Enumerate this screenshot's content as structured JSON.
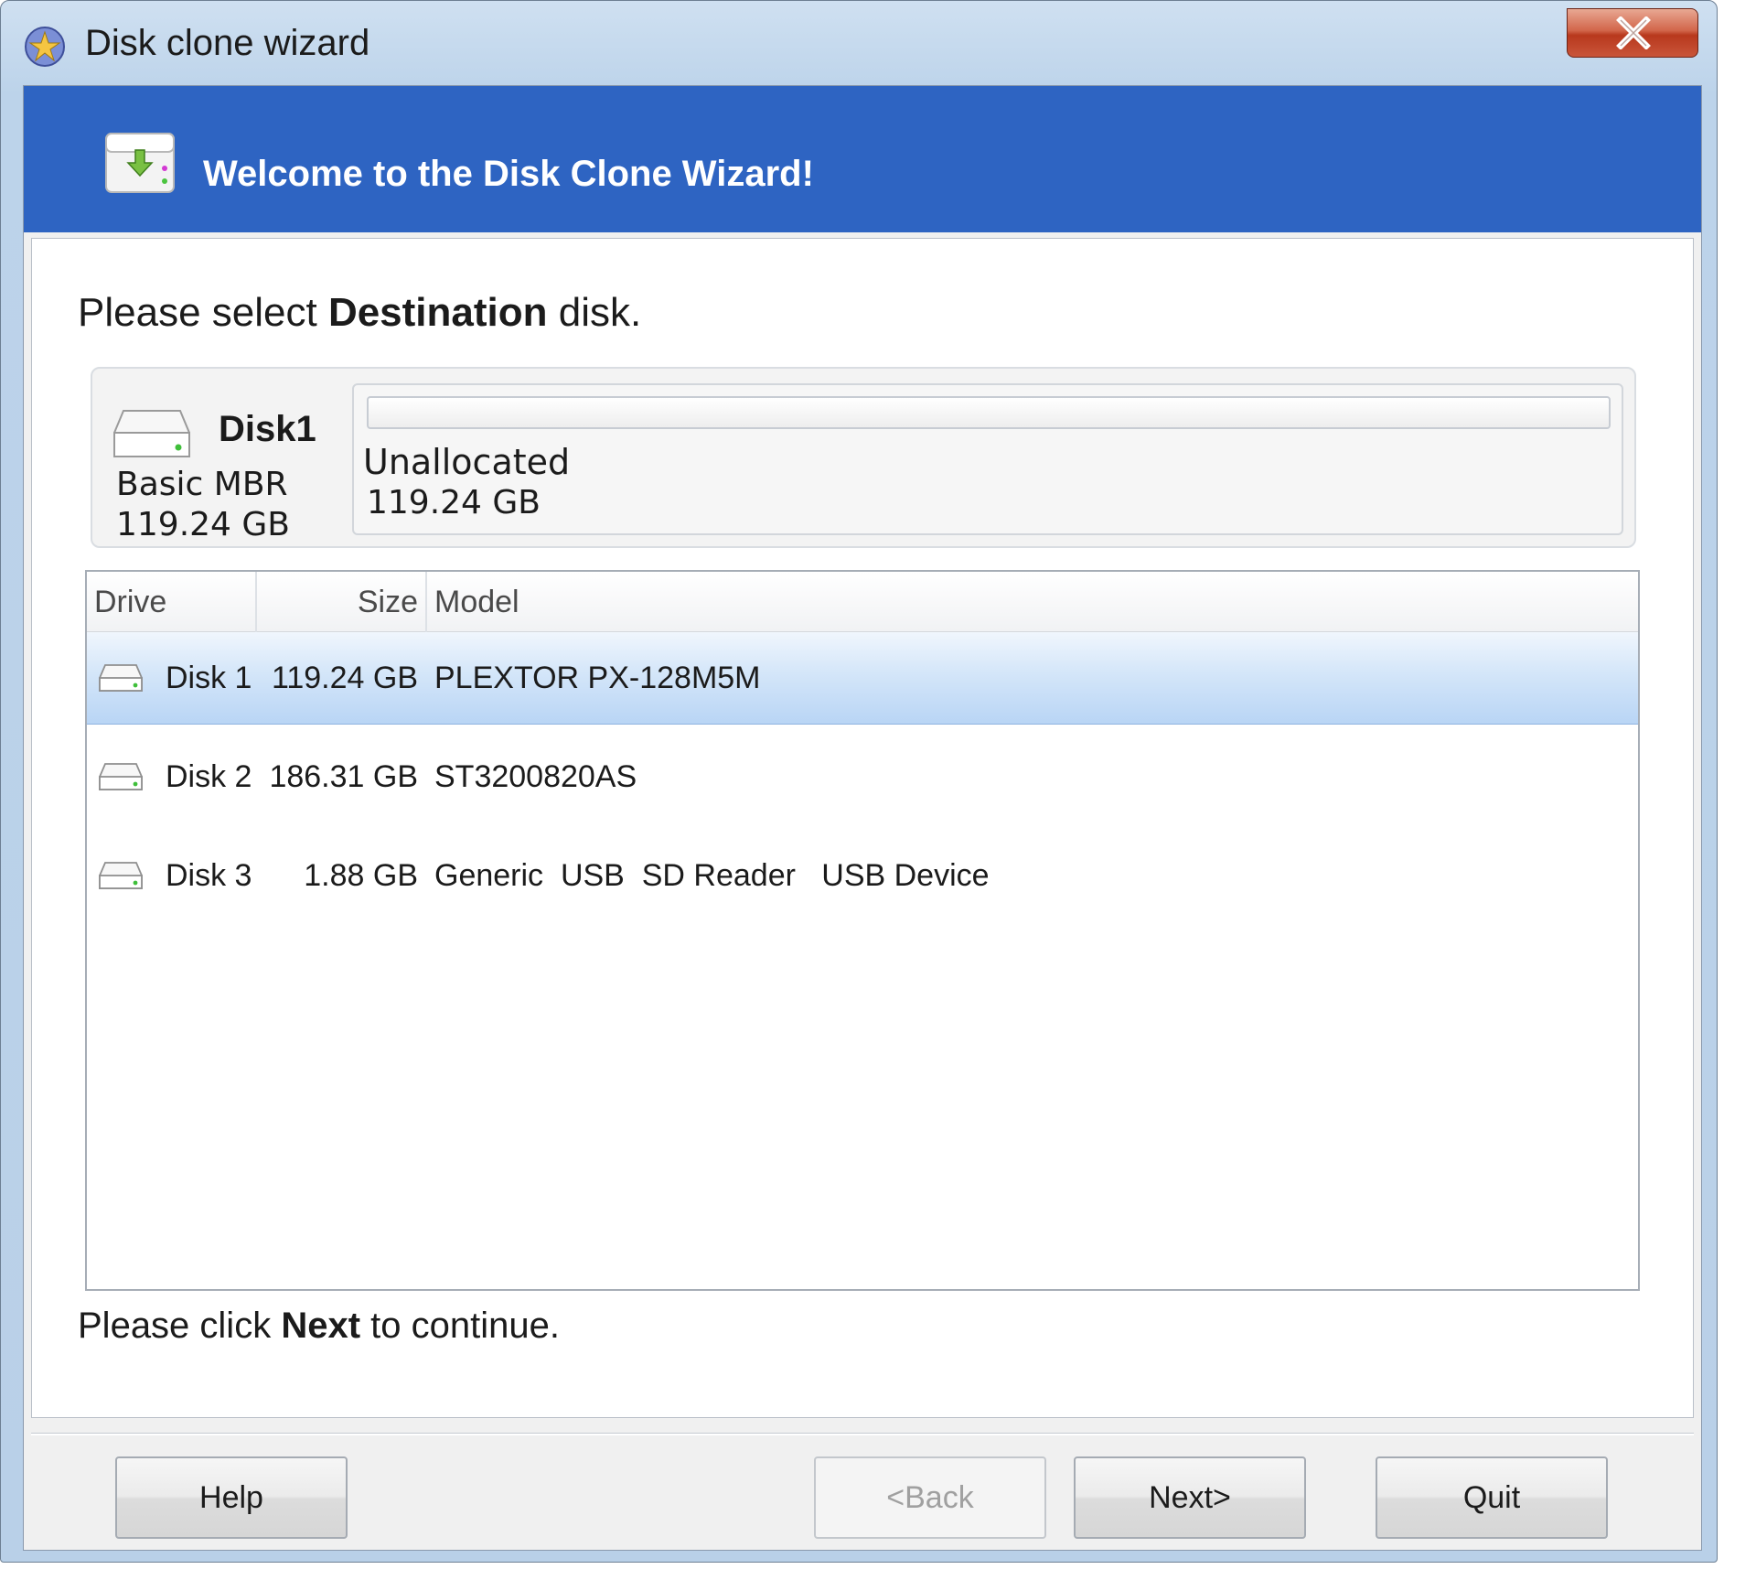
{
  "window": {
    "title": "Disk clone wizard"
  },
  "banner": {
    "title": "Welcome to the Disk Clone Wizard!"
  },
  "instruction": {
    "prefix": "Please select ",
    "bold": "Destination",
    "suffix": " disk."
  },
  "summary": {
    "disk_name": "Disk1",
    "disk_type": "Basic MBR",
    "disk_size": "119.24 GB",
    "partition_label": "Unallocated",
    "partition_size": "119.24 GB"
  },
  "table": {
    "columns": [
      "Drive",
      "Size",
      "Model"
    ],
    "rows": [
      {
        "drive": "Disk 1",
        "size": "119.24 GB",
        "model": "PLEXTOR PX-128M5M",
        "selected": true
      },
      {
        "drive": "Disk 2",
        "size": "186.31 GB",
        "model": "ST3200820AS",
        "selected": false
      },
      {
        "drive": "Disk 3",
        "size": "1.88 GB",
        "model": "Generic  USB  SD Reader   USB Device",
        "selected": false
      }
    ]
  },
  "footer_note": {
    "prefix": "Please click ",
    "bold": "Next",
    "suffix": " to continue."
  },
  "buttons": {
    "help": "Help",
    "back": "<Back",
    "next": "Next>",
    "quit": "Quit"
  },
  "icons": {
    "app": "app-icon",
    "close": "close-icon",
    "banner": "disk-clone-icon",
    "disk": "hard-disk-icon"
  },
  "colors": {
    "banner_blue": "#2e64c2",
    "selection": "#cfe2f8",
    "close_red": "#c9553a"
  }
}
